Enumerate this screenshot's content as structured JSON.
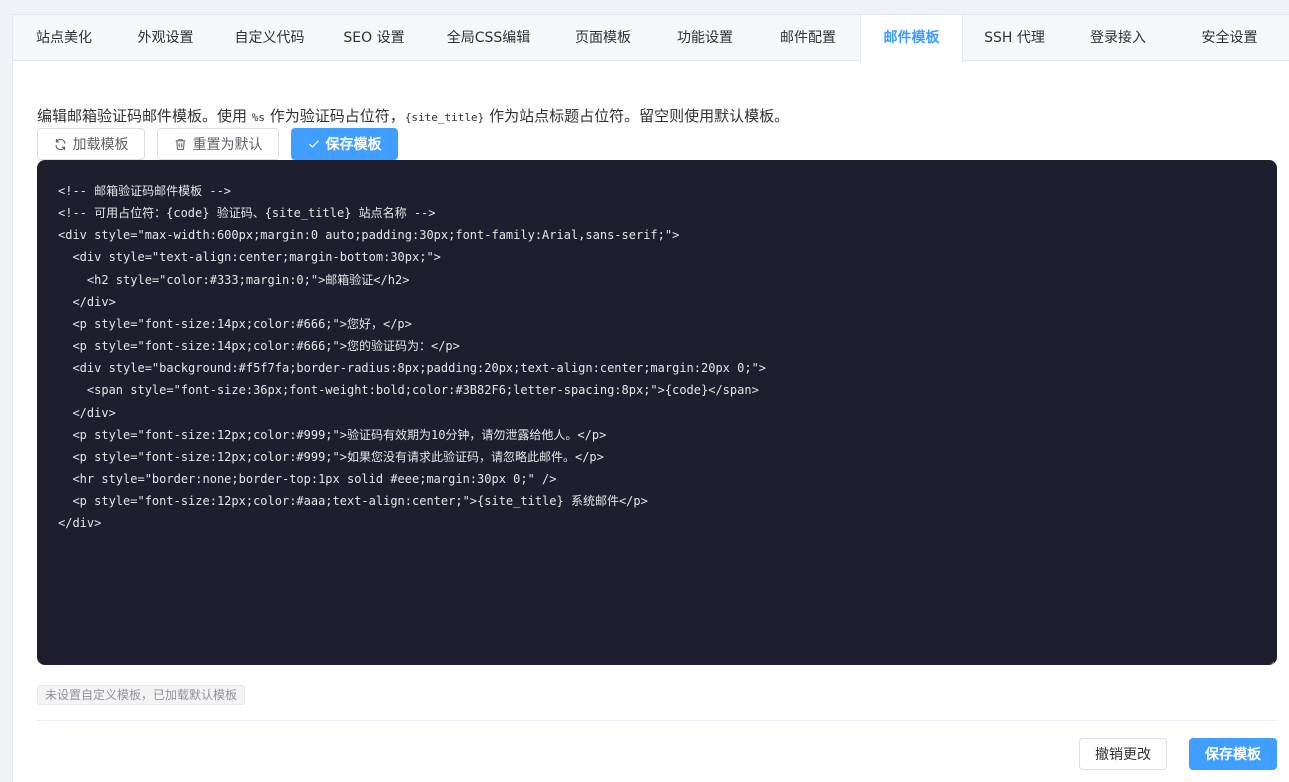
{
  "tabs": [
    {
      "label": "站点美化",
      "active": false
    },
    {
      "label": "外观设置",
      "active": false
    },
    {
      "label": "自定义代码",
      "active": false
    },
    {
      "label": "SEO 设置",
      "active": false
    },
    {
      "label": "全局CSS编辑",
      "active": false
    },
    {
      "label": "页面模板",
      "active": false
    },
    {
      "label": "功能设置",
      "active": false
    },
    {
      "label": "邮件配置",
      "active": false
    },
    {
      "label": "邮件模板",
      "active": true
    },
    {
      "label": "SSH 代理",
      "active": false
    },
    {
      "label": "登录接入",
      "active": false
    },
    {
      "label": "安全设置",
      "active": false
    }
  ],
  "description": {
    "part1": "编辑邮箱验证码邮件模板。使用 ",
    "code1": "%s",
    "part2": " 作为验证码占位符，",
    "code2": "{site_title}",
    "part3": " 作为站点标题占位符。留空则使用默认模板。"
  },
  "toolbar": {
    "load_label": "加载模板",
    "reset_label": "重置为默认",
    "save_label": "保存模板"
  },
  "editor": {
    "lines": [
      "<!-- 邮箱验证码邮件模板 -->",
      "<!-- 可用占位符：{code} 验证码、{site_title} 站点名称 -->",
      "<div style=\"max-width:600px;margin:0 auto;padding:30px;font-family:Arial,sans-serif;\">",
      "  <div style=\"text-align:center;margin-bottom:30px;\">",
      "    <h2 style=\"color:#333;margin:0;\">邮箱验证</h2>",
      "  </div>",
      "  <p style=\"font-size:14px;color:#666;\">您好，</p>",
      "  <p style=\"font-size:14px;color:#666;\">您的验证码为：</p>",
      "  <div style=\"background:#f5f7fa;border-radius:8px;padding:20px;text-align:center;margin:20px 0;\">",
      "    <span style=\"font-size:36px;font-weight:bold;color:#3B82F6;letter-spacing:8px;\">{code}</span>",
      "  </div>",
      "  <p style=\"font-size:12px;color:#999;\">验证码有效期为10分钟，请勿泄露给他人。</p>",
      "  <p style=\"font-size:12px;color:#999;\">如果您没有请求此验证码，请忽略此邮件。</p>",
      "  <hr style=\"border:none;border-top:1px solid #eee;margin:30px 0;\" />",
      "  <p style=\"font-size:12px;color:#aaa;text-align:center;\">{site_title} 系统邮件</p>",
      "</div>"
    ]
  },
  "hint": "未设置自定义模板，已加载默认模板",
  "footer": {
    "cancel_label": "撤销更改",
    "save_label": "保存模板"
  },
  "colors": {
    "primary": "#409eff",
    "editor_bg": "#1e1e2e"
  }
}
